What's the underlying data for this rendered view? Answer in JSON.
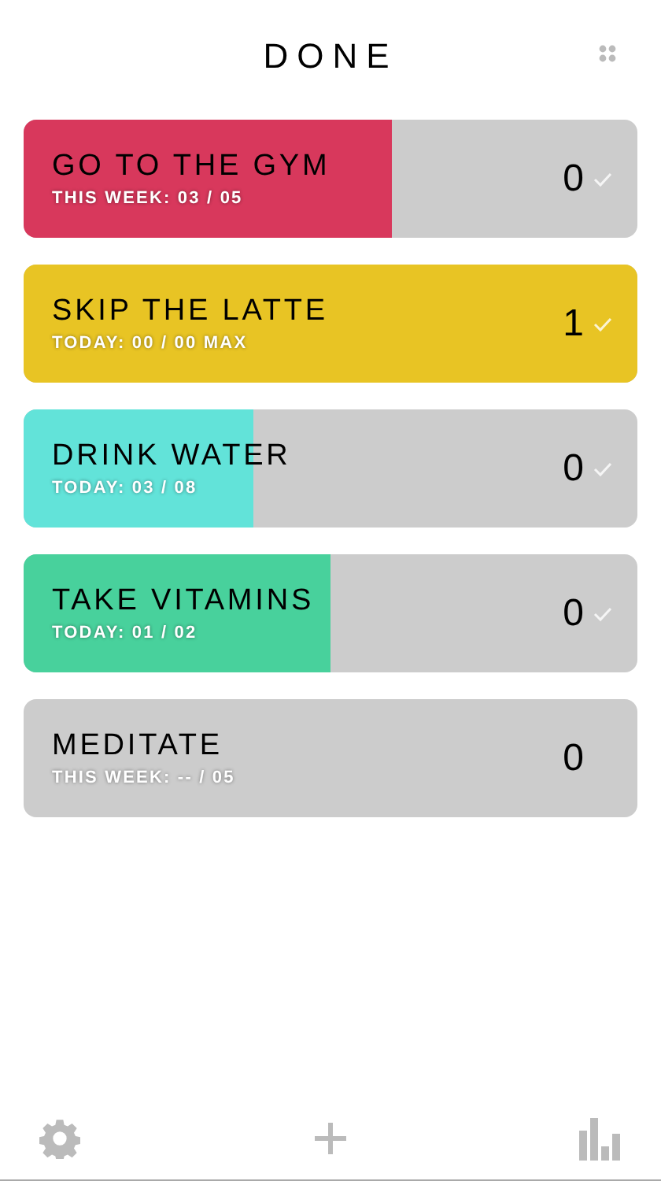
{
  "title": "DONE",
  "habits": [
    {
      "name": "GO TO THE GYM",
      "progress": "THIS WEEK: 03 / 05",
      "count": "0",
      "level": 0.6,
      "color": "#d8385c",
      "check": true
    },
    {
      "name": "SKIP THE LATTE",
      "progress": "TODAY: 00 / 00 MAX",
      "count": "1",
      "level": 1,
      "color": "#e8c424",
      "check": true
    },
    {
      "name": "DRINK WATER",
      "progress": "TODAY: 03 / 08",
      "count": "0",
      "level": 0.375,
      "color": "#62e3d9",
      "check": true
    },
    {
      "name": "TAKE VITAMINS",
      "progress": "TODAY: 01 / 02",
      "count": "0",
      "level": 0.5,
      "color": "#48d19c",
      "check": true
    },
    {
      "name": "MEDITATE",
      "progress": "THIS WEEK: -- / 05",
      "count": "0",
      "level": 0,
      "color": "#cccccc",
      "check": false
    }
  ]
}
